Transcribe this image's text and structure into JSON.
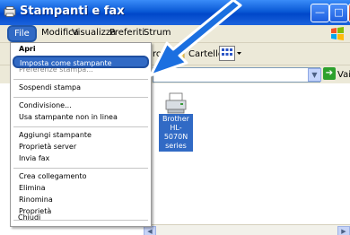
{
  "window": {
    "title": "Stampanti e fax"
  },
  "menubar": {
    "items": [
      "File",
      "Modifica",
      "Visualizza",
      "Preferiti",
      "Strum"
    ]
  },
  "toolbar": {
    "cerca": "rca",
    "cartelle": "Cartelle"
  },
  "address": {
    "go_label": "Vai"
  },
  "printer": {
    "line1": "Brother",
    "line2": "HL-5070N",
    "line3": "series"
  },
  "file_menu": {
    "apri": "Apri",
    "imposta": "Imposta come stampante predefinita",
    "ghost": "Preferenze stampa...",
    "sospendi": "Sospendi stampa",
    "condivisione": "Condivisione...",
    "non_in_linea": "Usa stampante non in linea",
    "aggiungi": "Aggiungi stampante",
    "server": "Proprietà server",
    "invia_fax": "Invia fax",
    "crea": "Crea collegamento",
    "elimina": "Elimina",
    "rinomina": "Rinomina",
    "proprieta": "Proprietà",
    "chiudi": "Chiudi"
  },
  "colors": {
    "title_bar": "#0a5ad6",
    "selection": "#316ac5",
    "arrow": "#1b6fe0"
  }
}
